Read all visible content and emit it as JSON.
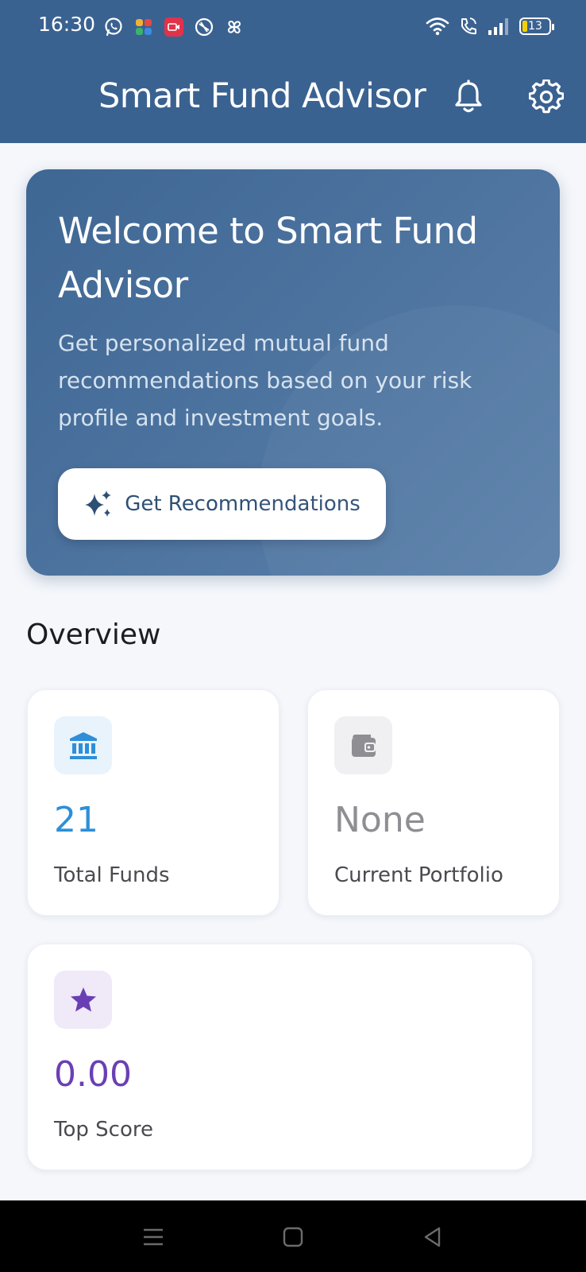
{
  "status_bar": {
    "time": "16:30",
    "battery": "13",
    "left_icons": [
      "whatsapp-icon",
      "colorful-app-icon",
      "video-app-icon",
      "compass-app-icon",
      "pinwheel-app-icon"
    ],
    "right_icons": [
      "wifi-icon",
      "call-icon",
      "signal-icon",
      "battery-icon"
    ]
  },
  "app_bar": {
    "title": "Smart Fund Advisor",
    "icons": [
      "bell-icon",
      "gear-icon"
    ]
  },
  "welcome": {
    "title": "Welcome to Smart Fund Advisor",
    "description": "Get personalized mutual fund recommendations based on your risk profile and investment goals.",
    "cta_label": "Get Recommendations",
    "cta_icon": "sparkle-icon"
  },
  "overview": {
    "heading": "Overview",
    "cards": [
      {
        "value": "21",
        "label": "Total Funds",
        "icon": "bank-icon",
        "accent": "#2e8fd8",
        "icon_bg": "#e8f3fc"
      },
      {
        "value": "None",
        "label": "Current Portfolio",
        "icon": "wallet-icon",
        "accent": "#8e8e93",
        "icon_bg": "#f0f0f2"
      },
      {
        "value": "0.00",
        "label": "Top Score",
        "icon": "star-icon",
        "accent": "#6a3fb5",
        "icon_bg": "#efe9f8"
      }
    ]
  },
  "colors": {
    "header": "#3a6291",
    "card_gradient_start": "#3f6794",
    "card_gradient_end": "#5b80aa",
    "background": "#f5f7fb"
  },
  "nav_bar": {
    "buttons": [
      "menu-icon",
      "home-icon",
      "back-icon"
    ]
  }
}
